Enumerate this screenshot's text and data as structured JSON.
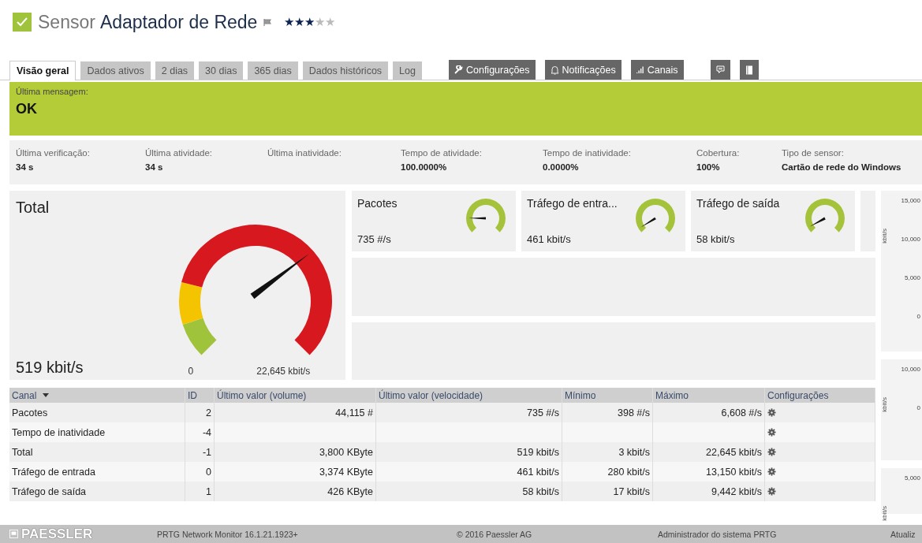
{
  "header": {
    "prefix": "Sensor",
    "title": "Adaptador de Rede",
    "status_ok": true,
    "stars": 3
  },
  "tabs": [
    {
      "label": "Visão geral",
      "selected": true
    },
    {
      "label": "Dados ativos",
      "selected": false
    },
    {
      "label": "2 dias",
      "selected": false
    },
    {
      "label": "30 dias",
      "selected": false
    },
    {
      "label": "365 dias",
      "selected": false
    },
    {
      "label": "Dados históricos",
      "selected": false
    },
    {
      "label": "Log",
      "selected": false
    }
  ],
  "actions": [
    {
      "kind": "wrench",
      "label": "Configurações"
    },
    {
      "kind": "bell",
      "label": "Notificações"
    },
    {
      "kind": "bars",
      "label": "Canais"
    },
    {
      "kind": "comment"
    },
    {
      "kind": "book"
    }
  ],
  "status": {
    "label": "Última mensagem:",
    "message": "OK"
  },
  "info": [
    {
      "label": "Última verificação:",
      "value": "34 s"
    },
    {
      "label": "Última atividade:",
      "value": "34 s"
    },
    {
      "label": "Última inatividade:"
    },
    {
      "label": "Tempo de atividade:",
      "value": "100.0000%"
    },
    {
      "label": "Tempo de inatividade:",
      "value": "0.0000%"
    },
    {
      "label": "Cobertura:",
      "value": "100%"
    },
    {
      "label": "Tipo de sensor:",
      "value": "Cartão de rede do Windows"
    }
  ],
  "main_gauge": {
    "title": "Total",
    "value": "519 kbit/s",
    "min_label": "0",
    "max_label": "22,645 kbit/s"
  },
  "small_gauges": [
    {
      "title": "Pacotes",
      "value": "735 #/s"
    },
    {
      "title": "Tráfego de entra...",
      "value": "461 kbit/s"
    },
    {
      "title": "Tráfego de saída",
      "value": "58 kbit/s"
    }
  ],
  "table": {
    "columns": [
      "Canal",
      "ID",
      "Último valor (volume)",
      "Último valor (velocidade)",
      "Mínimo",
      "Máximo",
      "Configurações"
    ],
    "rows": [
      {
        "channel": "Pacotes",
        "id": "2",
        "volume": "44,115 #",
        "speed": "735 #/s",
        "min": "398 #/s",
        "max": "6,608 #/s"
      },
      {
        "channel": "Tempo de inatividade",
        "id": "-4"
      },
      {
        "channel": "Total",
        "id": "-1",
        "volume": "3,800 KByte",
        "speed": "519 kbit/s",
        "min": "3 kbit/s",
        "max": "22,645 kbit/s"
      },
      {
        "channel": "Tráfego de entrada",
        "id": "0",
        "volume": "3,374 KByte",
        "speed": "461 kbit/s",
        "min": "280 kbit/s",
        "max": "13,150 kbit/s"
      },
      {
        "channel": "Tráfego de saída",
        "id": "1",
        "volume": "426 KByte",
        "speed": "58 kbit/s",
        "min": "17 kbit/s",
        "max": "9,442 kbit/s"
      }
    ]
  },
  "side_charts": [
    {
      "unit": "kbit/s",
      "ticks": [
        "15,000",
        "10,000",
        "5,000",
        "0"
      ]
    },
    {
      "unit": "kbit/s",
      "ticks": [
        "10,000",
        "0"
      ]
    },
    {
      "unit": "kbit/s",
      "ticks": [
        "5,000"
      ]
    }
  ],
  "footer": {
    "logo": "PAESSLER",
    "version": "PRTG Network Monitor 16.1.21.1923+",
    "copyright": "© 2016 Paessler AG",
    "user": "Administrador do sistema PRTG",
    "update": "Atualiz"
  }
}
